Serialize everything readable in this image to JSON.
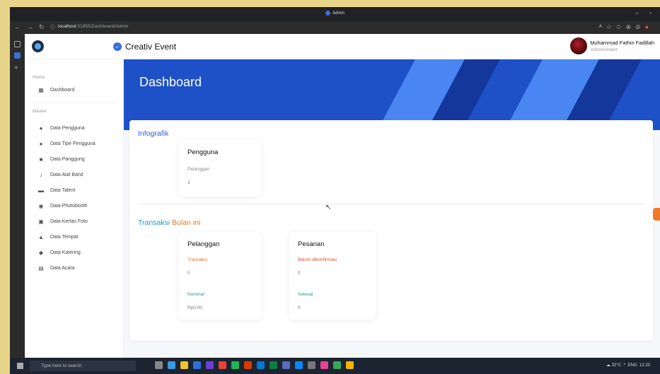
{
  "browser": {
    "window_title": "Admin",
    "url_host": "localhost",
    "url_rest": ":51955/Dashboard/Admin"
  },
  "app": {
    "title": "Creativ Event",
    "user": {
      "name": "Muhammad Fathin Fadillah",
      "role": "Administrator"
    }
  },
  "sidebar": {
    "sections": [
      {
        "heading": "Home",
        "items": [
          {
            "label": "Dashboard",
            "icon": "dashboard-icon"
          }
        ]
      },
      {
        "heading": "Master",
        "items": [
          {
            "label": "Data Pengguna",
            "icon": "user-icon"
          },
          {
            "label": "Data Tipe Pengguna",
            "icon": "users-icon"
          },
          {
            "label": "Data Panggung",
            "icon": "stage-icon"
          },
          {
            "label": "Data Alat Band",
            "icon": "microphone-icon"
          },
          {
            "label": "Data Talent",
            "icon": "talent-icon"
          },
          {
            "label": "Data Photobooth",
            "icon": "camera-icon"
          },
          {
            "label": "Data Kertas Foto",
            "icon": "photo-icon"
          },
          {
            "label": "Data Tempat",
            "icon": "place-icon"
          },
          {
            "label": "Data Katering",
            "icon": "catering-icon"
          },
          {
            "label": "Data Acara",
            "icon": "calendar-icon"
          }
        ]
      }
    ]
  },
  "main": {
    "page_title": "Dashboard",
    "infografik": {
      "title": "Infografik",
      "card": {
        "heading": "Pengguna",
        "key": "Pelanggan",
        "value": "3"
      }
    },
    "transaksi": {
      "title_a": "Transaksi",
      "title_b": "Bulan ini",
      "pelanggan": {
        "heading": "Pelanggan",
        "k1": "Transaksi",
        "v1": "0",
        "k2": "Nominal",
        "v2": "Rp0,00"
      },
      "pesanan": {
        "heading": "Pesanan",
        "k1": "Belum dikonfirmasi",
        "v1": "0",
        "k2": "Selesai",
        "v2": "0"
      }
    }
  },
  "taskbar": {
    "search_placeholder": "Type here to search",
    "weather": "32°C",
    "language": "ENG",
    "time": "12.20"
  },
  "colors": {
    "primary": "#2f5ad8",
    "hero": "#1e50c8",
    "orange": "#e06b2a",
    "green": "#1e9e86"
  }
}
